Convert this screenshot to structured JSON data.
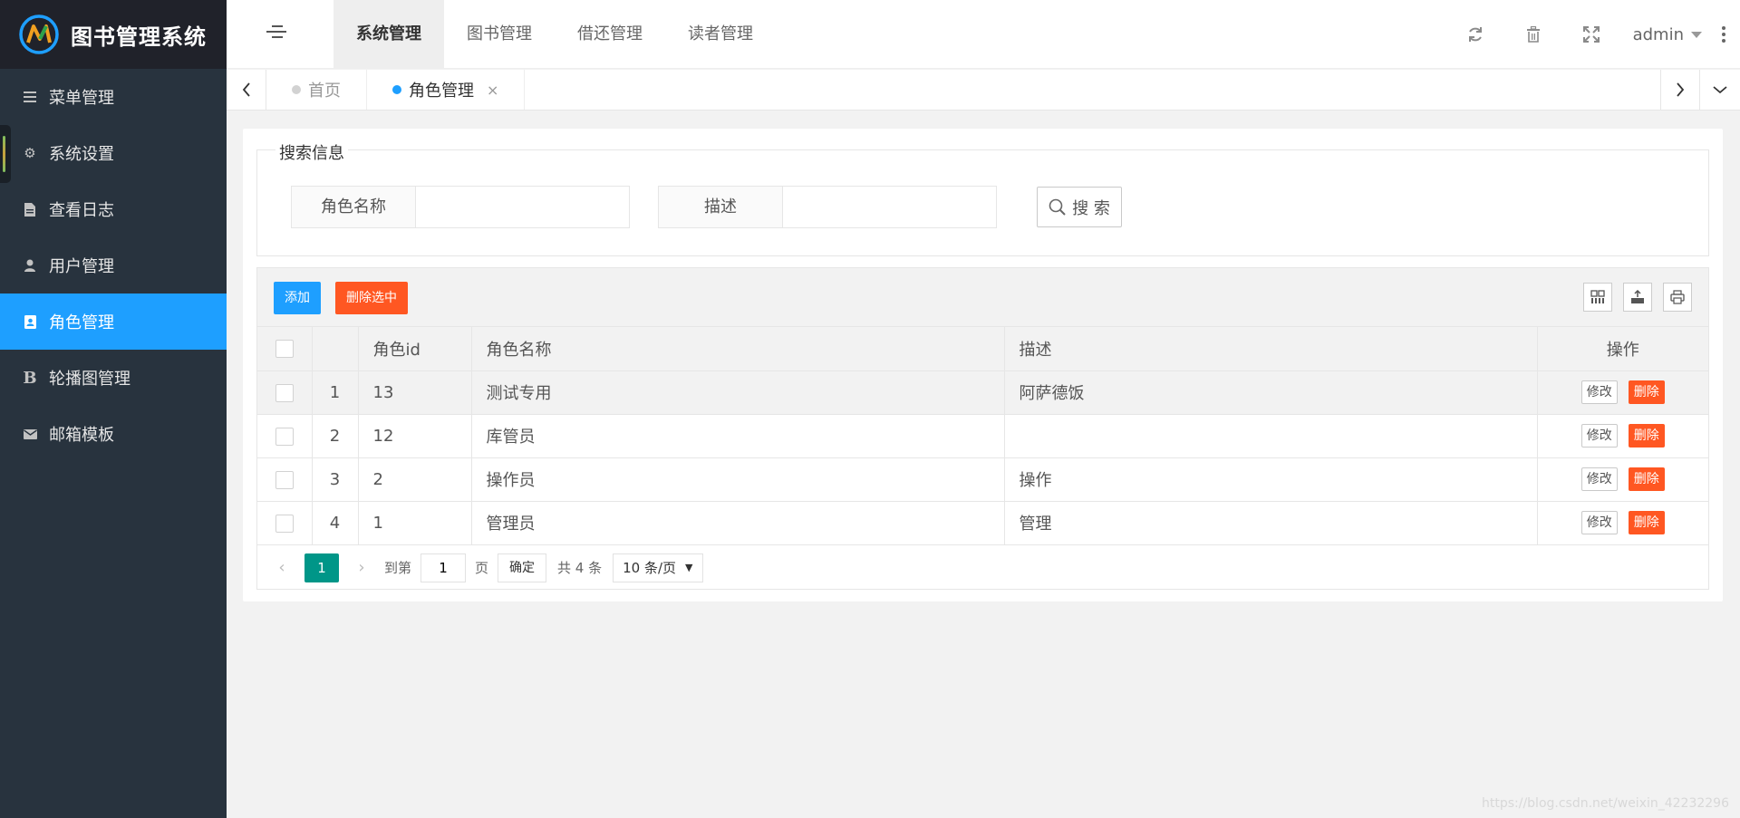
{
  "app": {
    "title": "图书管理系统",
    "colors": {
      "sidebar": "#28333e",
      "accent": "#1e9fff",
      "danger": "#ff5722",
      "pager": "#009688"
    }
  },
  "sidebar": {
    "items": [
      {
        "label": "菜单管理",
        "icon": "menu-icon"
      },
      {
        "label": "系统设置",
        "icon": "gear-icon"
      },
      {
        "label": "查看日志",
        "icon": "file-icon"
      },
      {
        "label": "用户管理",
        "icon": "user-icon"
      },
      {
        "label": "角色管理",
        "icon": "id-card-icon",
        "active": true
      },
      {
        "label": "轮播图管理",
        "icon": "bold-b-icon"
      },
      {
        "label": "邮箱模板",
        "icon": "envelope-icon"
      }
    ]
  },
  "header": {
    "nav": [
      {
        "label": "系统管理",
        "active": true
      },
      {
        "label": "图书管理"
      },
      {
        "label": "借还管理"
      },
      {
        "label": "读者管理"
      }
    ],
    "user": "admin"
  },
  "tabs": [
    {
      "label": "首页"
    },
    {
      "label": "角色管理",
      "active": true,
      "close": "×"
    }
  ],
  "search": {
    "legend": "搜索信息",
    "role_name_label": "角色名称",
    "desc_label": "描述",
    "button": "搜 索"
  },
  "toolbar": {
    "add": "添加",
    "delete_selected": "删除选中"
  },
  "table": {
    "columns": [
      "角色id",
      "角色名称",
      "描述",
      "操作"
    ],
    "rows": [
      {
        "num": "1",
        "id": "13",
        "name": "测试专用",
        "desc": "阿萨德饭"
      },
      {
        "num": "2",
        "id": "12",
        "name": "库管员",
        "desc": ""
      },
      {
        "num": "3",
        "id": "2",
        "name": "操作员",
        "desc": "操作"
      },
      {
        "num": "4",
        "id": "1",
        "name": "管理员",
        "desc": "管理"
      }
    ],
    "edit_label": "修改",
    "delete_label": "删除"
  },
  "pager": {
    "current": "1",
    "goto_label": "到第",
    "page_input": "1",
    "page_label": "页",
    "confirm": "确定",
    "total": "共 4 条",
    "page_size": "10 条/页"
  },
  "watermark": "https://blog.csdn.net/weixin_42232296"
}
